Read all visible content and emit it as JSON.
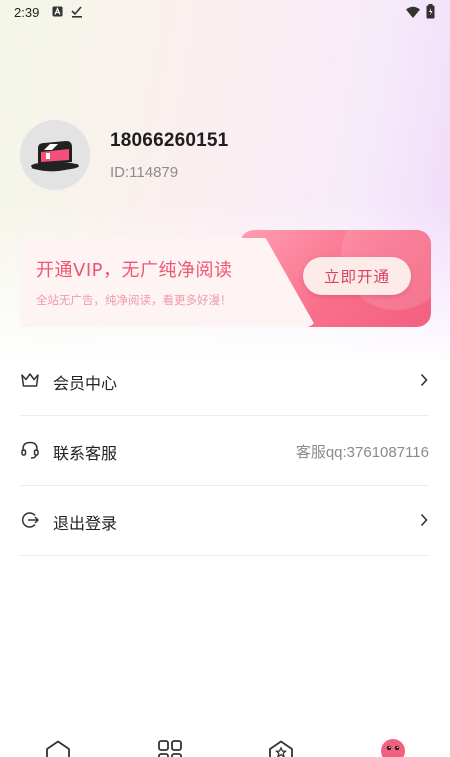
{
  "status_bar": {
    "time": "2:39",
    "icons": [
      "notification-a-icon",
      "check-download-icon",
      "wifi-icon",
      "battery-icon"
    ]
  },
  "profile": {
    "phone": "18066260151",
    "id": "ID:114879",
    "avatar_icon": "hat-logo-icon"
  },
  "vip": {
    "title": "开通VIP，无广纯净阅读",
    "subtitle": "全站无广告，纯净阅读，看更多好漫！",
    "button": "立即开通"
  },
  "menu": [
    {
      "label": "会员中心",
      "icon": "crown-icon",
      "value": "",
      "chevron": true
    },
    {
      "label": "联系客服",
      "icon": "headset-icon",
      "value": "客服qq:3761087116",
      "chevron": false
    },
    {
      "label": "退出登录",
      "icon": "logout-icon",
      "value": "",
      "chevron": true
    }
  ],
  "tabs": [
    {
      "icon": "home-icon",
      "active": false
    },
    {
      "icon": "grid-icon",
      "active": false
    },
    {
      "icon": "star-house-icon",
      "active": false
    },
    {
      "icon": "mine-face-icon",
      "active": true
    }
  ],
  "colors": {
    "accent": "#f2607f",
    "vip_title": "#ef5573",
    "text": "#222222",
    "muted": "#8a8a8a"
  }
}
